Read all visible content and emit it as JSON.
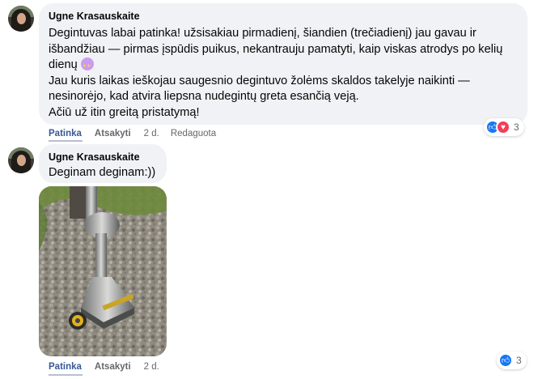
{
  "comments": [
    {
      "author": "Ugne Krasauskaite",
      "lines": [
        "Degintuvas labai patinka! užsisakiau pirmadienį, šiandien (trečiadienį) jau gavau ir",
        "išbandžiau — pirmas įspūdis puikus, nekantrauju pamatyti, kaip viskas atrodys po kelių",
        "dienų",
        "Jau kuris laikas ieškojau saugesnio degintuvo žolėms skaldos takelyje naikinti —",
        "nesinorėjo, kad atvira liepsna nudegintų greta esančią veją.",
        "Ačiū už itin greitą pristatymą!"
      ],
      "actions": {
        "like": "Patinka",
        "reply": "Atsakyti",
        "time": "2 d.",
        "edited": "Redaguota"
      },
      "reactions": {
        "icons": [
          "like-icon",
          "love-icon"
        ],
        "count": "3"
      }
    },
    {
      "author": "Ugne Krasauskaite",
      "lines": [
        "Deginam deginam:))"
      ],
      "actions": {
        "like": "Patinka",
        "reply": "Atsakyti",
        "time": "2 d."
      },
      "reactions": {
        "icons": [
          "like-icon"
        ],
        "count": "3"
      },
      "photo": "weed-burner-on-gravel-path"
    }
  ],
  "colors": {
    "bubble": "#f0f2f5",
    "link": "#385898",
    "meta": "#65676b",
    "like": "#1877f2",
    "love": "#f33e58"
  }
}
